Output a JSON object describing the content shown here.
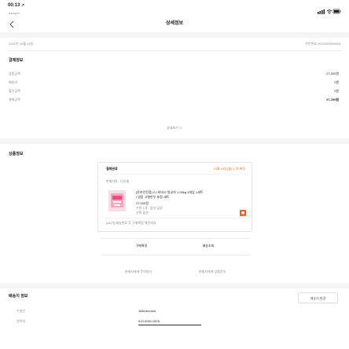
{
  "status_bar": {
    "time": "00:13",
    "location_icon": "location-arrow-icon",
    "sub_label": "◂ payco",
    "signal_icon": "signal-icon",
    "wifi_icon": "wifi-icon",
    "battery_icon": "battery-icon"
  },
  "header": {
    "back_icon": "chevron-left-icon",
    "title": "상세정보"
  },
  "order": {
    "date": "2021년 10월 14일",
    "number": "주문번호 2021000000484"
  },
  "payment": {
    "title": "결제정보",
    "rows": [
      {
        "label": "상품금액",
        "value": "27,200원"
      },
      {
        "label": "배송비",
        "value": "0원"
      },
      {
        "label": "할인금액",
        "value": "0원"
      },
      {
        "label": "결제금액",
        "value": "27,200원"
      }
    ],
    "more_label": "상세보기 ∨"
  },
  "product_info": {
    "title": "상품정보",
    "status": "결제완료",
    "status_note": "10월 18일(월) 도착 예정",
    "seller": "판매자명 · 다온몰",
    "name_line1": "[온라인전용] CJ 비비고 왕교자 1.05kg 3개입 1세트",
    "name_line2": "/ 냉동 고향만두 포함 세트",
    "price": "27,200원",
    "qty": "수량 1개 · 옵션 없음",
    "option": "선택 옵션",
    "cart_icon": "cart-icon",
    "notice": "[AA기] 배송완료 후 구매확정 해주세요"
  },
  "actions": {
    "primary": [
      "구매확정",
      "배송조회"
    ],
    "secondary": [
      "판매자에게 문의하기",
      "판매자에게 상품문의"
    ]
  },
  "shipping": {
    "title": "배송지 정보",
    "edit_label": "배송지 변경",
    "rows": [
      {
        "label": "수령인",
        "value": "1681thenton"
      },
      {
        "label": "연락처",
        "value": "010-0000-0578"
      }
    ]
  }
}
